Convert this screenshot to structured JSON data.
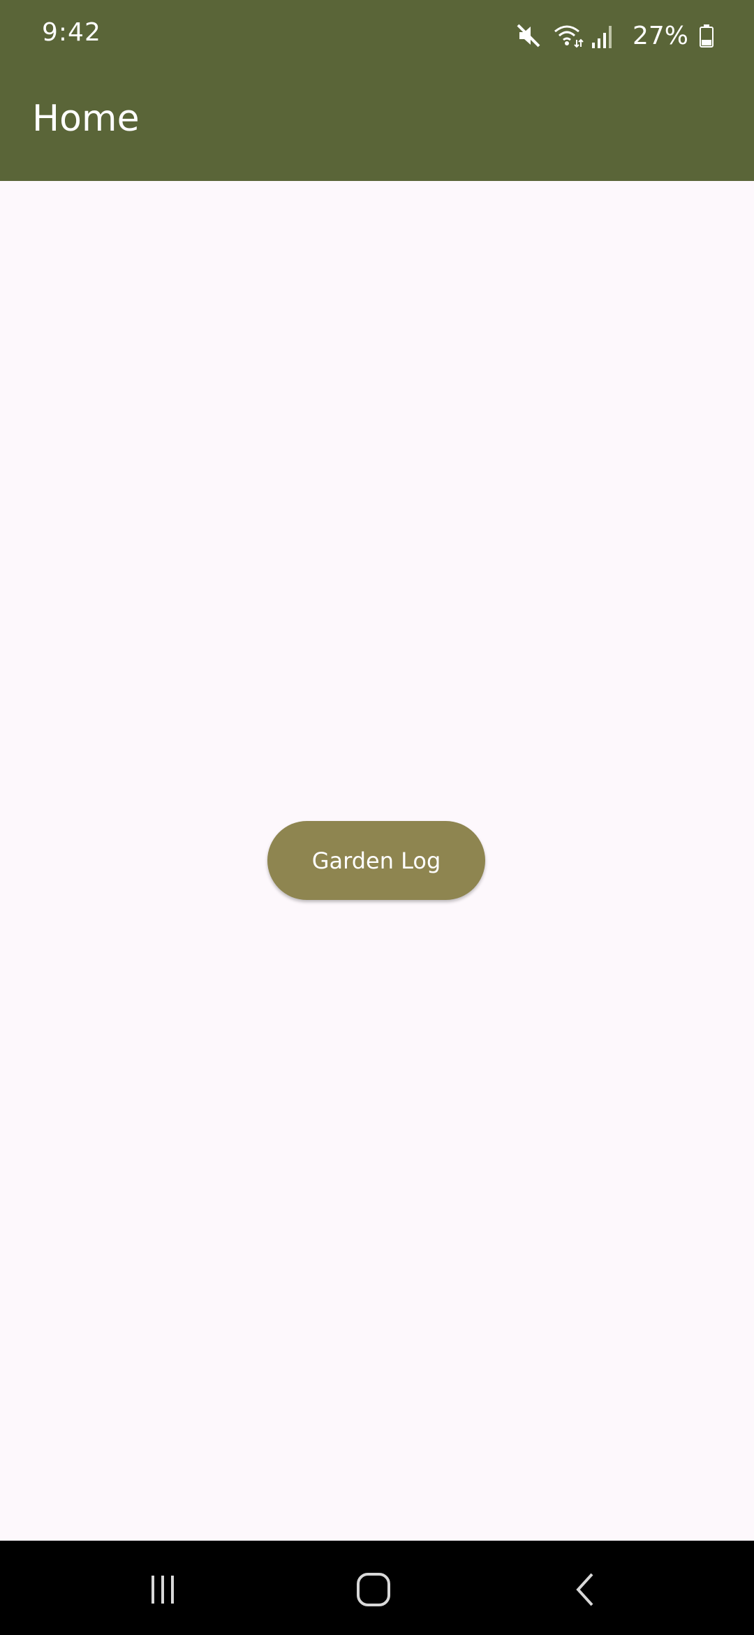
{
  "status_bar": {
    "time": "9:42",
    "battery_text": "27%",
    "icons": [
      "mute-icon",
      "wifi-icon",
      "signal-icon",
      "battery-icon"
    ]
  },
  "app_bar": {
    "title": "Home"
  },
  "main": {
    "button_label": "Garden Log"
  },
  "nav_bar": {
    "icons": [
      "recents-icon",
      "home-icon",
      "back-icon"
    ]
  },
  "colors": {
    "app_bar": "#5a6538",
    "background": "#fdf8fc",
    "button": "#8e8550",
    "nav_bar": "#000000"
  }
}
